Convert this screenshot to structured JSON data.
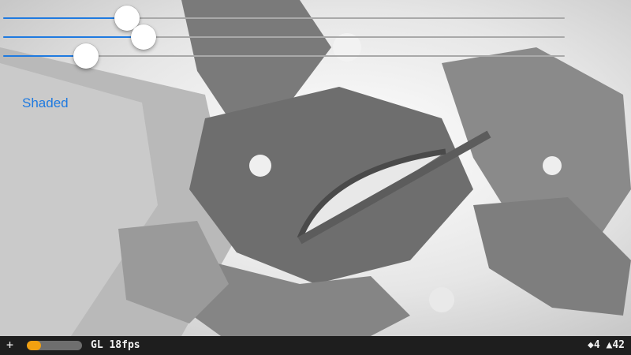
{
  "colors": {
    "accent": "#1f7ae0",
    "track": "#a9a9a9",
    "thumb": "#ffffff",
    "status_bar_bg": "#1e1e1e",
    "progress_fill": "#f2a010",
    "progress_track": "#6e6e6e"
  },
  "sliders": [
    {
      "value": 0.22
    },
    {
      "value": 0.25
    },
    {
      "value": 0.148
    }
  ],
  "shading_button": {
    "label": "Shaded"
  },
  "status_bar": {
    "add_label": "+",
    "progress": 0.25,
    "renderer_label": "GL 18fps",
    "nodes_label": "◆4",
    "triangles_label": "▲42"
  },
  "scene": {
    "icon": "panoramic-3d-scene"
  }
}
